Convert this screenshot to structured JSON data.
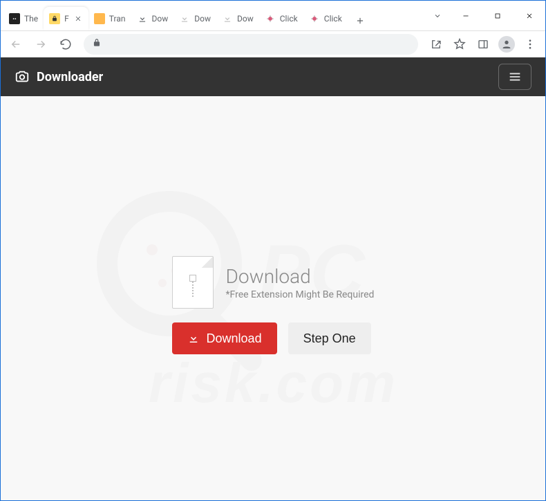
{
  "tabs": [
    {
      "label": "The",
      "icon": "dark"
    },
    {
      "label": "F",
      "icon": "lock",
      "active": true
    },
    {
      "label": "Tran",
      "icon": "trans"
    },
    {
      "label": "Dow",
      "icon": "download"
    },
    {
      "label": "Dow",
      "icon": "download-grey"
    },
    {
      "label": "Dow",
      "icon": "download-grey"
    },
    {
      "label": "Click",
      "icon": "click"
    },
    {
      "label": "Click",
      "icon": "click"
    }
  ],
  "site": {
    "brand": "Downloader"
  },
  "card": {
    "title": "Download",
    "subtitle": "*Free Extension Might Be Required"
  },
  "buttons": {
    "download": "Download",
    "step": "Step One"
  }
}
